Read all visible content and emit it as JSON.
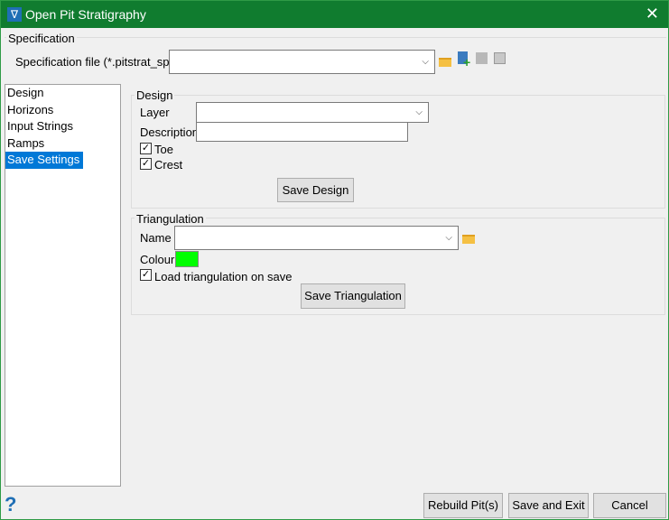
{
  "window": {
    "title": "Open Pit Stratigraphy",
    "close": "✕",
    "app_icon": "∇"
  },
  "specification": {
    "group": "Specification",
    "file_label": "Specification file (*.pitstrat_spec)",
    "file_value": ""
  },
  "nav": {
    "items": [
      {
        "label": "Design"
      },
      {
        "label": "Horizons"
      },
      {
        "label": "Input Strings"
      },
      {
        "label": "Ramps"
      },
      {
        "label": "Save Settings"
      }
    ],
    "selected": "Save Settings"
  },
  "design": {
    "group": "Design",
    "layer_label": "Layer",
    "layer_value": "",
    "description_label": "Description",
    "description_value": "",
    "toe_label": "Toe",
    "toe_checked": true,
    "crest_label": "Crest",
    "crest_checked": true,
    "save_button": "Save Design"
  },
  "triangulation": {
    "group": "Triangulation",
    "name_label": "Name",
    "name_value": "",
    "colour_label": "Colour",
    "colour": "#00ff00",
    "load_label": "Load triangulation on save",
    "load_checked": true,
    "save_button": "Save Triangulation"
  },
  "footer": {
    "help": "?",
    "rebuild": "Rebuild Pit(s)",
    "save_exit": "Save and Exit",
    "cancel": "Cancel"
  }
}
